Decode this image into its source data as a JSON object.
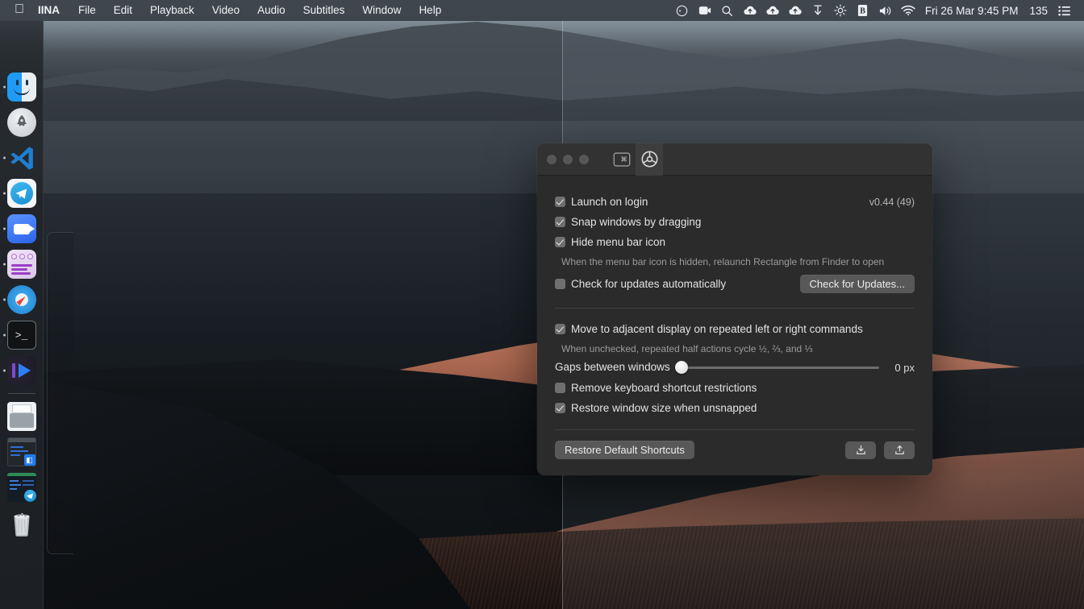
{
  "menubar": {
    "apple_icon": "apple-logo-icon",
    "items": [
      {
        "label": "IINA",
        "bold": true
      },
      {
        "label": "File",
        "bold": false
      },
      {
        "label": "Edit",
        "bold": false
      },
      {
        "label": "Playback",
        "bold": false
      },
      {
        "label": "Video",
        "bold": false
      },
      {
        "label": "Audio",
        "bold": false
      },
      {
        "label": "Subtitles",
        "bold": false
      },
      {
        "label": "Window",
        "bold": false
      },
      {
        "label": "Help",
        "bold": false
      }
    ],
    "status_icons": [
      "siri-icon",
      "screen-recording-icon",
      "spotlight-search-icon",
      "cloud-upload-icon",
      "cloud-upload-icon",
      "cloud-upload-icon",
      "downloads-arrow-icon",
      "brightness-icon",
      "bartender-icon",
      "volume-icon",
      "wifi-icon"
    ],
    "clock": "Fri 26 Mar  9:45 PM",
    "battery_percent": "135",
    "control_center_icon": "control-center-icon"
  },
  "dock": {
    "items": [
      {
        "name": "finder",
        "running": true
      },
      {
        "name": "launchpad",
        "running": false
      },
      {
        "name": "visual-studio-code",
        "running": true
      },
      {
        "name": "telegram",
        "running": true
      },
      {
        "name": "zoom",
        "running": true
      },
      {
        "name": "podcasts",
        "running": true
      },
      {
        "name": "safari",
        "running": true
      },
      {
        "name": "terminal",
        "running": true
      },
      {
        "name": "iina",
        "running": true
      }
    ],
    "minimized": [
      {
        "name": "minimized-window-code",
        "badge": "◧"
      },
      {
        "name": "minimized-window-telegram",
        "badge": "➤"
      }
    ],
    "printer": {
      "name": "printer-queue"
    },
    "trash": {
      "name": "trash"
    }
  },
  "window": {
    "title_bar": {
      "traffic_lights": [
        "close",
        "minimize",
        "zoom"
      ],
      "tabs": [
        {
          "name": "shortcuts-tab",
          "icon": "keyboard-command-key-icon",
          "selected": false
        },
        {
          "name": "settings-tab",
          "icon": "gear-icon",
          "selected": true
        }
      ]
    },
    "version": "v0.44 (49)",
    "section_one": {
      "launch_on_login": {
        "label": "Launch on login",
        "checked": true
      },
      "snap_windows": {
        "label": "Snap windows by dragging",
        "checked": true
      },
      "hide_menu_bar_icon": {
        "label": "Hide menu bar icon",
        "checked": true
      },
      "hide_menu_bar_hint": "When the menu bar icon is hidden, relaunch Rectangle from Finder to open",
      "check_updates_auto": {
        "label": "Check for updates automatically",
        "checked": false
      },
      "check_updates_button": "Check for Updates..."
    },
    "section_two": {
      "move_adjacent": {
        "label": "Move to adjacent display on repeated left or right commands",
        "checked": true
      },
      "move_adjacent_hint": "When unchecked, repeated half actions cycle ½, ⅔, and ⅓",
      "gaps": {
        "label": "Gaps between windows",
        "value": 0,
        "min": 0,
        "max": 100,
        "value_display": "0 px"
      },
      "remove_restrictions": {
        "label": "Remove keyboard shortcut restrictions",
        "checked": false
      },
      "restore_size": {
        "label": "Restore window size when unsnapped",
        "checked": true
      }
    },
    "footer": {
      "restore_defaults_button": "Restore Default Shortcuts",
      "import_button_icon": "import-tray-icon",
      "export_button_icon": "export-share-icon"
    }
  },
  "colors": {
    "window_bg": "#2b2b2b",
    "title_bar_bg": "#323232",
    "button_bg": "#585858",
    "menubar_bg": "#2e343a",
    "accent_text": "#e8e8e8"
  }
}
